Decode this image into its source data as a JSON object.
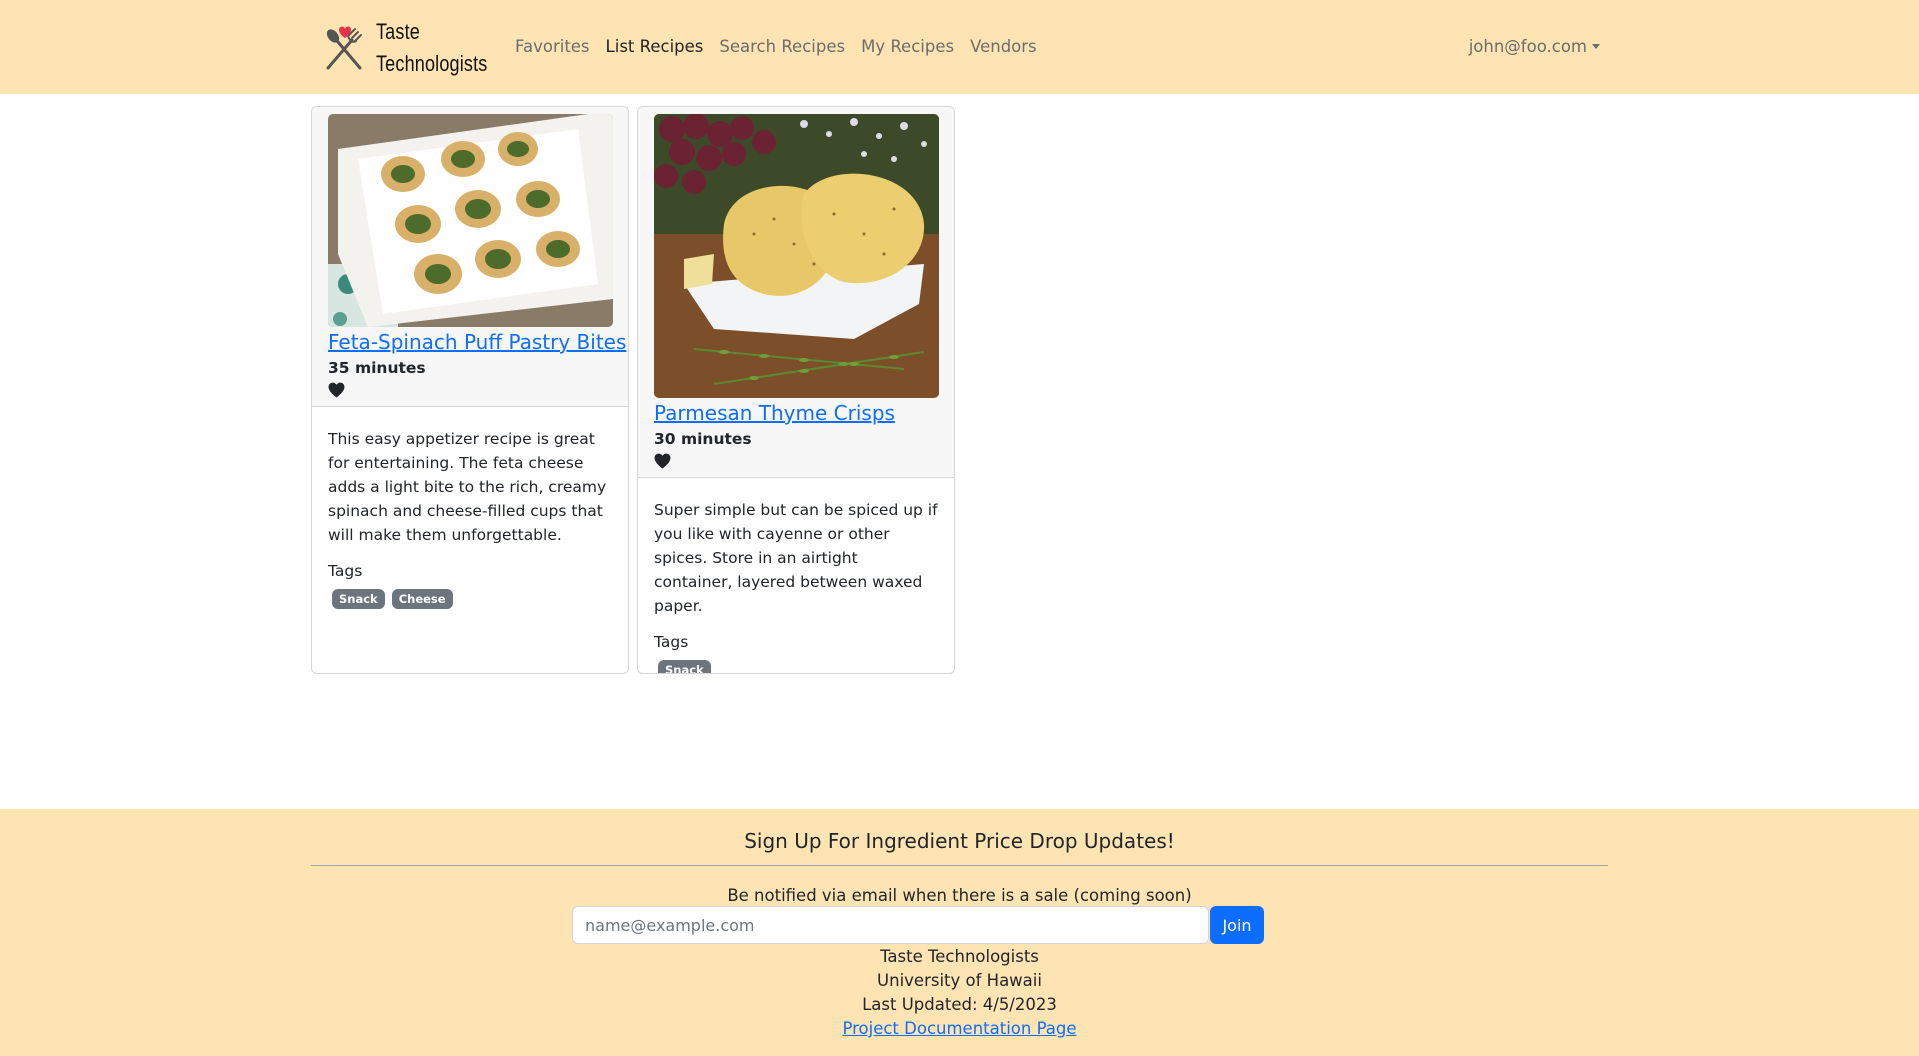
{
  "navbar": {
    "brand_line1": "Taste",
    "brand_line2": "Technologists",
    "brand_icon": "crossed-fork-spoon-heart-icon",
    "links": [
      {
        "label": "Favorites",
        "active": false
      },
      {
        "label": "List Recipes",
        "active": true
      },
      {
        "label": "Search Recipes",
        "active": false
      },
      {
        "label": "My Recipes",
        "active": false
      },
      {
        "label": "Vendors",
        "active": false
      }
    ],
    "user_email": "john@foo.com"
  },
  "recipes": [
    {
      "title": "Feta-Spinach Puff Pastry Bites",
      "time": "35 minutes",
      "favorite_icon": "heart-icon",
      "description": "This easy appetizer recipe is great for entertaining. The feta cheese adds a light bite to the rich, creamy spinach and cheese-filled cups that will make them unforgettable.",
      "tags_label": "Tags",
      "tags": [
        "Snack",
        "Cheese"
      ]
    },
    {
      "title": "Parmesan Thyme Crisps",
      "time": "30 minutes",
      "favorite_icon": "heart-icon",
      "description": "Super simple but can be spiced up if you like with cayenne or other spices. Store in an airtight container, layered between waxed paper.",
      "tags_label": "Tags",
      "tags": [
        "Snack"
      ]
    }
  ],
  "footer": {
    "title": "Sign Up For Ingredient Price Drop Updates!",
    "subtitle": "Be notified via email when there is a sale (coming soon)",
    "email_placeholder": "name@example.com",
    "email_value": "",
    "join_label": "Join",
    "org_name": "Taste Technologists",
    "university": "University of Hawaii",
    "last_updated": "Last Updated: 4/5/2023",
    "doc_link": "Project Documentation Page"
  },
  "colors": {
    "navbar_bg": "#ffe4b3",
    "footer_bg": "#ffe4b3",
    "link_blue": "#0d6efd",
    "badge_gray": "#6c757d",
    "heart_red": "#e8334a"
  }
}
